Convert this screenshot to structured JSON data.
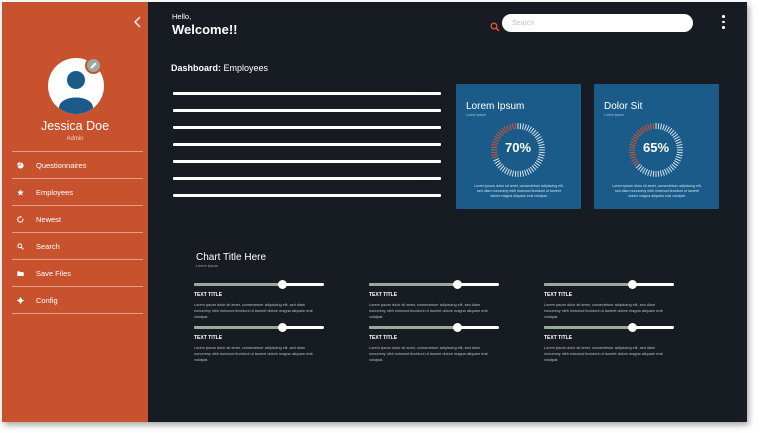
{
  "header": {
    "greeting": "Hello,",
    "welcome": "Welcome!!",
    "search_placeholder": "Search"
  },
  "profile": {
    "name": "Jessica Doe",
    "role": "Admin"
  },
  "sidebar": {
    "items": [
      {
        "label": "Questionnaires",
        "icon": "pie-chart-icon"
      },
      {
        "label": "Employees",
        "icon": "star-icon"
      },
      {
        "label": "Newest",
        "icon": "refresh-icon"
      },
      {
        "label": "Search",
        "icon": "search-icon"
      },
      {
        "label": "Save Files",
        "icon": "folder-icon"
      },
      {
        "label": "Config",
        "icon": "gear-icon"
      }
    ]
  },
  "dashboard": {
    "label": "Dashboard:",
    "section": "Employees"
  },
  "cards": [
    {
      "title": "Lorem Ipsum",
      "subtitle": "Lorem ipsum",
      "percent": 70,
      "percent_label": "70%",
      "text": "Lorem ipsum dolor sit amet, consectetuer adipiscing elit, sed diam nonummy nibh euismod tincidunt ut laoreet dolore magna aliquam erat volutpat."
    },
    {
      "title": "Dolor Sit",
      "subtitle": "Lorem ipsum",
      "percent": 65,
      "percent_label": "65%",
      "text": "Lorem ipsum dolor sit amet, consectetuer adipiscing elit, sed diam nonummy nibh euismod tincidunt ut laoreet dolore magna aliquam erat volutpat."
    }
  ],
  "chart": {
    "title": "Chart Title Here",
    "subtitle": "Lorem ipsum",
    "sliders": [
      {
        "label": "TEXT TITLE",
        "value": 0.68,
        "text": "Lorem ipsum dolor sit amet, consectetuer adipiscing elit, sed diam nonummy nibh euismod tincidunt ut laoreet dolore magna aliquam erat volutpat."
      },
      {
        "label": "TEXT TITLE",
        "value": 0.68,
        "text": "Lorem ipsum dolor sit amet, consectetuer adipiscing elit, sed diam nonummy nibh euismod tincidunt ut laoreet dolore magna aliquam erat volutpat."
      },
      {
        "label": "TEXT TITLE",
        "value": 0.68,
        "text": "Lorem ipsum dolor sit amet, consectetuer adipiscing elit, sed diam nonummy nibh euismod tincidunt ut laoreet dolore magna aliquam erat volutpat."
      },
      {
        "label": "TEXT TITLE",
        "value": 0.68,
        "text": "Lorem ipsum dolor sit amet, consectetuer adipiscing elit, sed diam nonummy nibh euismod tincidunt ut laoreet dolore magna aliquam erat volutpat."
      },
      {
        "label": "TEXT TITLE",
        "value": 0.68,
        "text": "Lorem ipsum dolor sit amet, consectetuer adipiscing elit, sed diam nonummy nibh euismod tincidunt ut laoreet dolore magna aliquam erat volutpat."
      },
      {
        "label": "TEXT TITLE",
        "value": 0.68,
        "text": "Lorem ipsum dolor sit amet, consectetuer adipiscing elit, sed diam nonummy nibh euismod tincidunt ut laoreet dolore magna aliquam erat volutpat."
      }
    ]
  },
  "colors": {
    "sidebar": "#c8512e",
    "background": "#161c22",
    "card": "#1b5b89",
    "accent": "#e8542a",
    "slider_fill": "#9aa9a0"
  }
}
